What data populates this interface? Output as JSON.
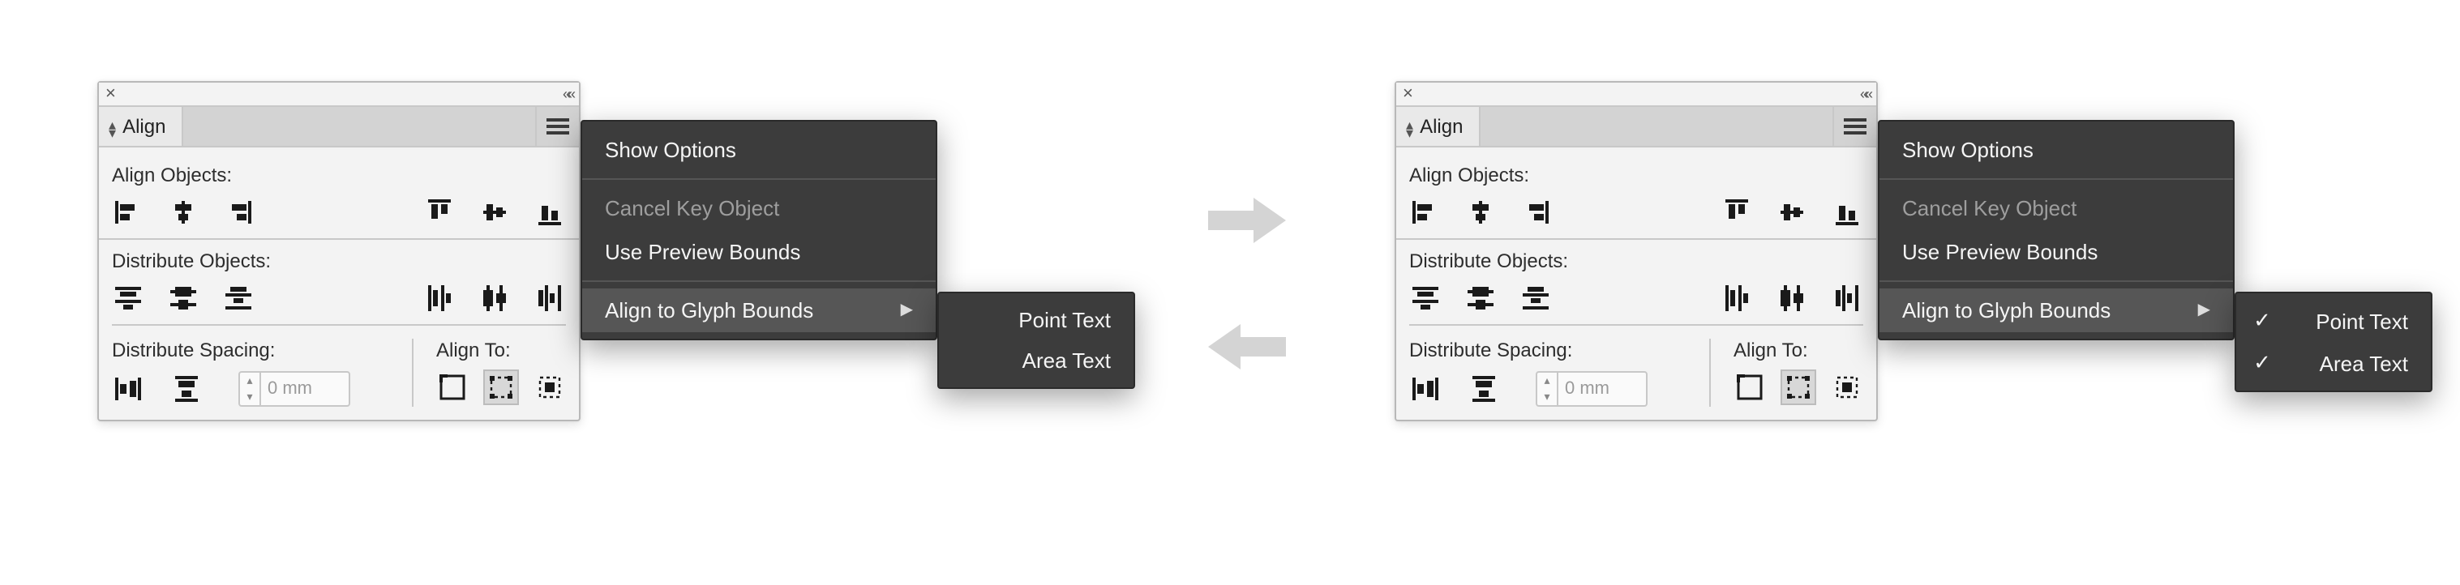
{
  "panel": {
    "title": "Align",
    "section_align_objects": "Align Objects:",
    "section_distribute_objects": "Distribute Objects:",
    "section_distribute_spacing": "Distribute Spacing:",
    "section_align_to": "Align To:",
    "spacing_value": "0 mm"
  },
  "menu": {
    "show_options": "Show Options",
    "cancel_key_object": "Cancel Key Object",
    "use_preview_bounds": "Use Preview Bounds",
    "align_to_glyph_bounds": "Align to Glyph Bounds"
  },
  "submenu": {
    "point_text": "Point Text",
    "area_text": "Area Text"
  },
  "state": {
    "left": {
      "point_text_checked": false,
      "area_text_checked": false
    },
    "right": {
      "point_text_checked": true,
      "area_text_checked": true
    }
  }
}
